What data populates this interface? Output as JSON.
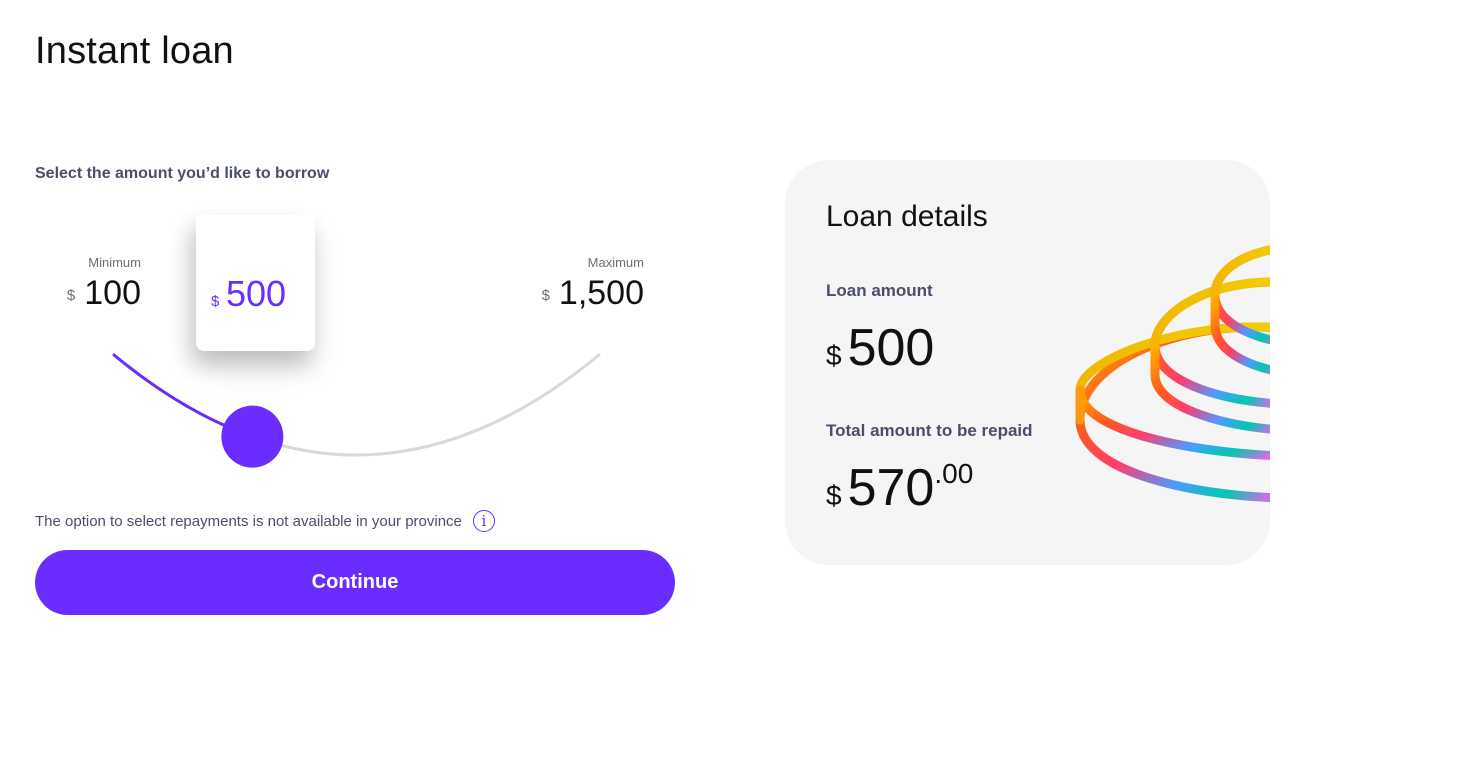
{
  "page": {
    "title": "Instant loan"
  },
  "selector": {
    "prompt": "Select the amount you’d like to borrow",
    "currency_symbol": "$",
    "minimum": {
      "caption": "Minimum",
      "amount": "100"
    },
    "maximum": {
      "caption": "Maximum",
      "amount": "1,500"
    },
    "selected_amount": "500",
    "slider_fraction": 0.2857,
    "accent_color": "#6a2cff",
    "track_color": "#d9d9d9"
  },
  "notice": {
    "text": "The option to select repayments is not available in your province",
    "icon": "info-icon",
    "icon_glyph": "i"
  },
  "actions": {
    "continue_label": "Continue"
  },
  "loan_details": {
    "title": "Loan details",
    "currency_symbol": "$",
    "loan_amount_label": "Loan amount",
    "loan_amount": "500",
    "total_label": "Total amount to be repaid",
    "total_whole": "570",
    "total_cents": ".00",
    "illustration": "rainbow-rings-illustration"
  }
}
